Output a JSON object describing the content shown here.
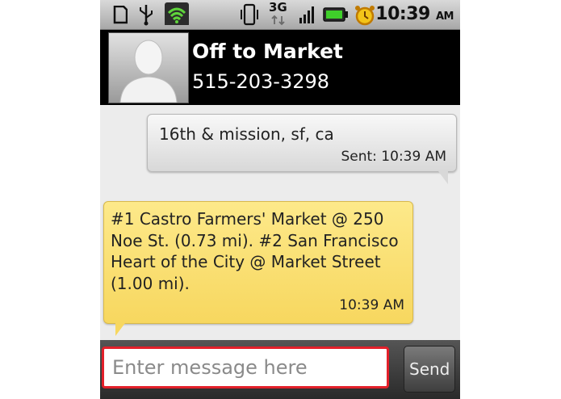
{
  "status_bar": {
    "icons": [
      "sd-card-icon",
      "usb-icon",
      "wifi-tether-icon",
      "vibrate-icon",
      "network-3g-icon",
      "signal-icon",
      "battery-icon",
      "alarm-icon"
    ],
    "network_label": "3G",
    "time": "10:39",
    "ampm": "AM"
  },
  "header": {
    "contact_name": "Off to Market",
    "contact_phone": "515-203-3298"
  },
  "messages": [
    {
      "direction": "sent",
      "text": "16th & mission, sf, ca",
      "time": "Sent: 10:39 AM"
    },
    {
      "direction": "received",
      "text": "#1 Castro Farmers' Market @ 250 Noe St. (0.73 mi). #2 San Francisco Heart of the City @ Market Street (1.00 mi).",
      "time": "10:39 AM"
    }
  ],
  "compose": {
    "placeholder": "Enter message here",
    "send_label": "Send"
  },
  "colors": {
    "received_bubble": "#f9dc6a",
    "sent_bubble": "#e8e8e8",
    "input_highlight": "#e3202a"
  }
}
